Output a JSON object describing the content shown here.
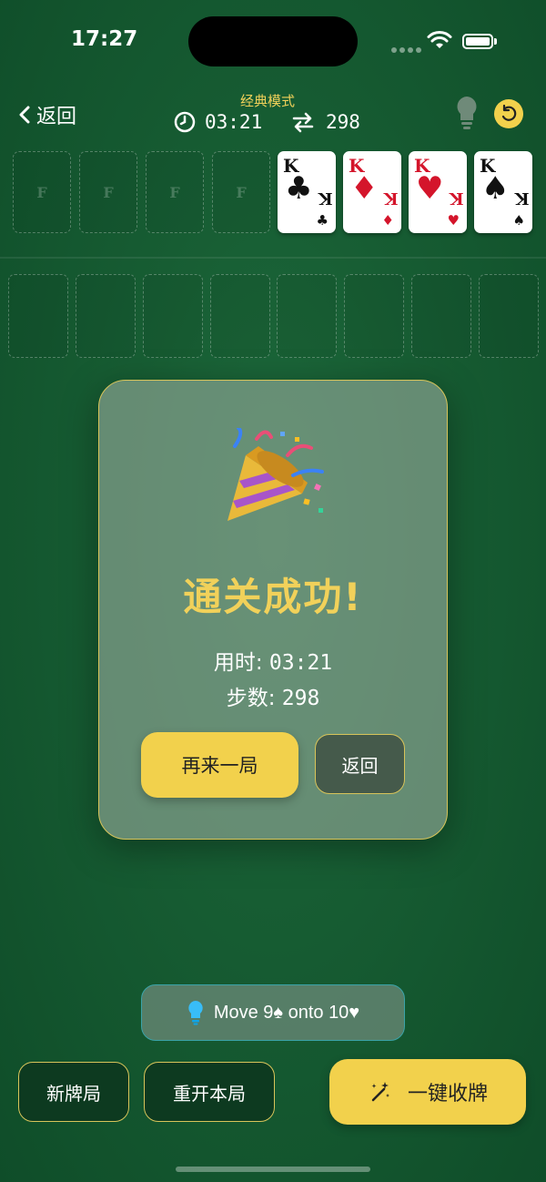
{
  "status": {
    "time": "17:27"
  },
  "header": {
    "back_label": "返回",
    "mode": "经典模式",
    "timer": "03:21",
    "moves": "298"
  },
  "foundation": {
    "free_cell_label": "F",
    "cards": [
      {
        "rank": "K",
        "suit": "♣",
        "color": "black"
      },
      {
        "rank": "K",
        "suit": "♦",
        "color": "red"
      },
      {
        "rank": "K",
        "suit": "♥",
        "color": "red"
      },
      {
        "rank": "K",
        "suit": "♠",
        "color": "black"
      }
    ]
  },
  "modal": {
    "emoji": "🎉",
    "title": "通关成功!",
    "time_label": "用时:",
    "time_value": "03:21",
    "moves_label": "步数:",
    "moves_value": "298",
    "again_button": "再来一局",
    "back_button": "返回"
  },
  "hint": {
    "text": "Move 9♠ onto 10♥"
  },
  "bottom": {
    "new_game": "新牌局",
    "restart": "重开本局",
    "auto_collect": "一键收牌"
  },
  "colors": {
    "accent": "#f2d14c",
    "felt": "#175d33",
    "title": "#f1d15a"
  }
}
